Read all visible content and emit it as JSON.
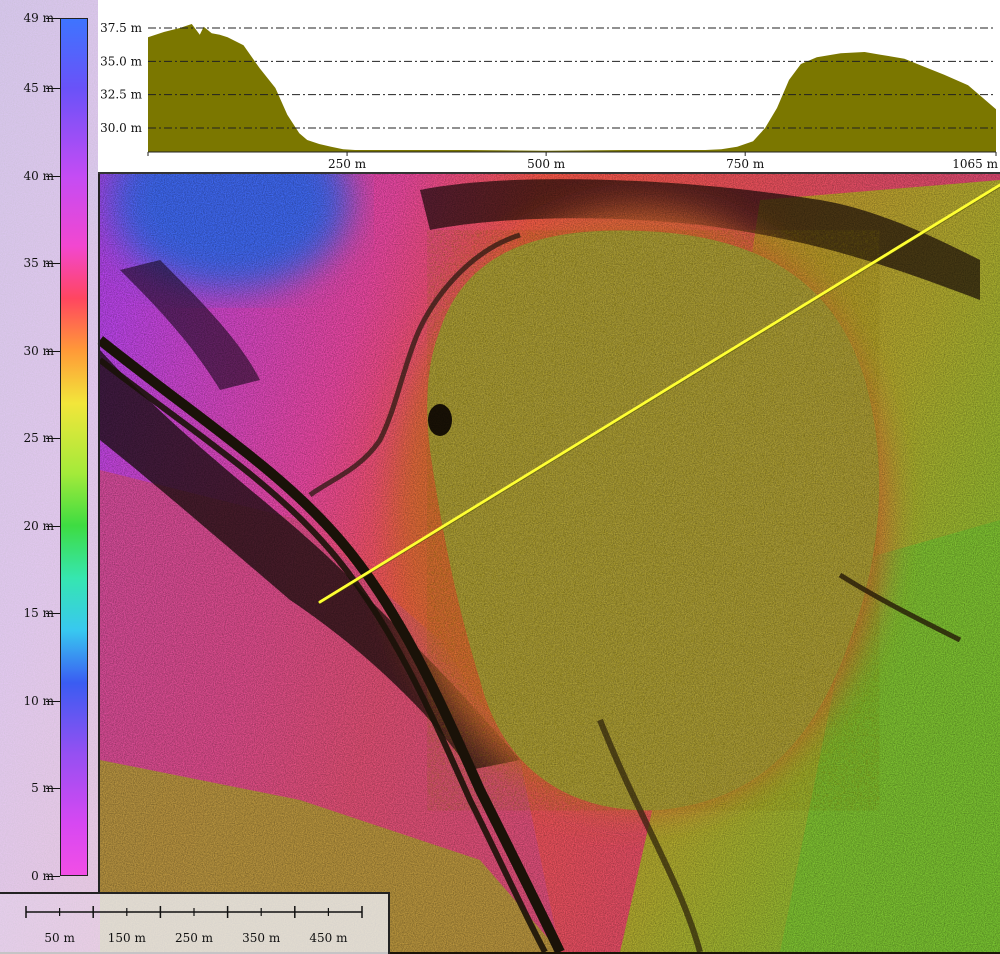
{
  "map": {
    "description_colors": {
      "terrace": "#b3a43c",
      "road_dark": "#2a2208",
      "profile_line": "#ffff33"
    }
  },
  "legend": {
    "unit": "m",
    "labels": [
      "49 m",
      "45 m",
      "40 m",
      "35 m",
      "30 m",
      "25 m",
      "20 m",
      "15 m",
      "10 m",
      "5 m",
      "0 m"
    ],
    "values": [
      49,
      45,
      40,
      35,
      30,
      25,
      20,
      15,
      10,
      5,
      0
    ],
    "max": 49,
    "min": 0,
    "gradient_stops": [
      {
        "value": 49,
        "color": "#3e74ff"
      },
      {
        "value": 45,
        "color": "#6a52f8"
      },
      {
        "value": 40,
        "color": "#c44cf4"
      },
      {
        "value": 36,
        "color": "#f247d0"
      },
      {
        "value": 33,
        "color": "#ff4660"
      },
      {
        "value": 30,
        "color": "#ff9a38"
      },
      {
        "value": 27,
        "color": "#f2e63a"
      },
      {
        "value": 23,
        "color": "#a4ea3a"
      },
      {
        "value": 20,
        "color": "#3edc42"
      },
      {
        "value": 17,
        "color": "#36e6b0"
      },
      {
        "value": 14,
        "color": "#38c8f0"
      },
      {
        "value": 11,
        "color": "#3a5cf2"
      },
      {
        "value": 7,
        "color": "#9450f2"
      },
      {
        "value": 3,
        "color": "#d648f2"
      },
      {
        "value": 0,
        "color": "#f24ee6"
      }
    ]
  },
  "chart_data": {
    "type": "area",
    "title": "",
    "xlabel": "",
    "ylabel": "",
    "x_tick_labels": [
      "250 m",
      "500 m",
      "750 m",
      "1065 m"
    ],
    "x_ticks": [
      250,
      500,
      750,
      1065
    ],
    "y_tick_labels": [
      "37.5 m",
      "35.0 m",
      "32.5 m",
      "30.0 m"
    ],
    "y_ticks": [
      37.5,
      35.0,
      32.5,
      30.0
    ],
    "xlim": [
      0,
      1065
    ],
    "ylim": [
      28.2,
      39.0
    ],
    "grid": "horizontal dash-dot",
    "fill_color": "#7b7700",
    "x": [
      0,
      20,
      40,
      55,
      65,
      70,
      80,
      90,
      100,
      120,
      140,
      160,
      175,
      190,
      200,
      215,
      230,
      245,
      260,
      300,
      400,
      500,
      600,
      700,
      720,
      740,
      760,
      775,
      790,
      805,
      820,
      840,
      870,
      900,
      920,
      950,
      970,
      1000,
      1030,
      1065
    ],
    "y": [
      36.8,
      37.2,
      37.5,
      37.8,
      37.0,
      37.6,
      37.1,
      37.0,
      36.8,
      36.2,
      34.5,
      33.0,
      31.0,
      29.6,
      29.1,
      28.8,
      28.6,
      28.4,
      28.35,
      28.35,
      28.35,
      28.3,
      28.35,
      28.35,
      28.4,
      28.6,
      29.0,
      30.0,
      31.5,
      33.6,
      34.8,
      35.3,
      35.6,
      35.7,
      35.5,
      35.2,
      34.7,
      34.0,
      33.2,
      31.4
    ]
  },
  "scale": {
    "labels": [
      "50 m",
      "150 m",
      "250 m",
      "350 m",
      "450 m"
    ],
    "label_values": [
      50,
      150,
      250,
      350,
      450
    ],
    "major_values": [
      0,
      100,
      200,
      300,
      400,
      500
    ],
    "minor_values": [
      50,
      150,
      250,
      350,
      450
    ],
    "max": 500
  }
}
